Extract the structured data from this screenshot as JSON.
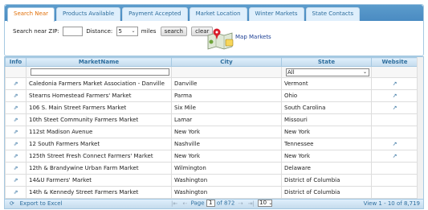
{
  "tabs": [
    {
      "label": "Search Near",
      "active": true
    },
    {
      "label": "Products Available",
      "active": false
    },
    {
      "label": "Payment Accepted",
      "active": false
    },
    {
      "label": "Market Location",
      "active": false
    },
    {
      "label": "Winter Markets",
      "active": false
    },
    {
      "label": "State Contacts",
      "active": false
    }
  ],
  "search": {
    "zip_label": "Search near ZIP:",
    "zip_value": "",
    "distance_label": "Distance:",
    "distance_value": "5",
    "miles_label": "miles",
    "search_button": "search",
    "clear_button": "clear",
    "map_label": "Map Markets"
  },
  "grid": {
    "columns": [
      "Info",
      "MarketName",
      "City",
      "State",
      "Website"
    ],
    "filter_state_value": "All",
    "rows": [
      {
        "name": "Caledonia Farmers Market Association - Danville",
        "city": "Danville",
        "state": "Vermont",
        "website": true
      },
      {
        "name": "Stearns Homestead Farmers' Market",
        "city": "Parma",
        "state": "Ohio",
        "website": true
      },
      {
        "name": "106 S. Main Street Farmers Market",
        "city": "Six Mile",
        "state": "South Carolina",
        "website": true
      },
      {
        "name": "10th Steet Community Farmers Market",
        "city": "Lamar",
        "state": "Missouri",
        "website": false
      },
      {
        "name": "112st Madison Avenue",
        "city": "New York",
        "state": "New York",
        "website": false
      },
      {
        "name": "12 South Farmers Market",
        "city": "Nashville",
        "state": "Tennessee",
        "website": true
      },
      {
        "name": "125th Street Fresh Connect Farmers' Market",
        "city": "New York",
        "state": "New York",
        "website": true
      },
      {
        "name": "12th & Brandywine Urban Farm Market",
        "city": "Wilmington",
        "state": "Delaware",
        "website": false
      },
      {
        "name": "14&U Farmers' Market",
        "city": "Washington",
        "state": "District of Columbia",
        "website": false
      },
      {
        "name": "14th & Kennedy Street Farmers Market",
        "city": "Washington",
        "state": "District of Columbia",
        "website": false
      }
    ]
  },
  "pager": {
    "export_label": "Export to Excel",
    "page_label": "Page",
    "page_value": "1",
    "of_label": "of 872",
    "rows_value": "10",
    "view_label": "View 1 - 10 of 8,719"
  }
}
